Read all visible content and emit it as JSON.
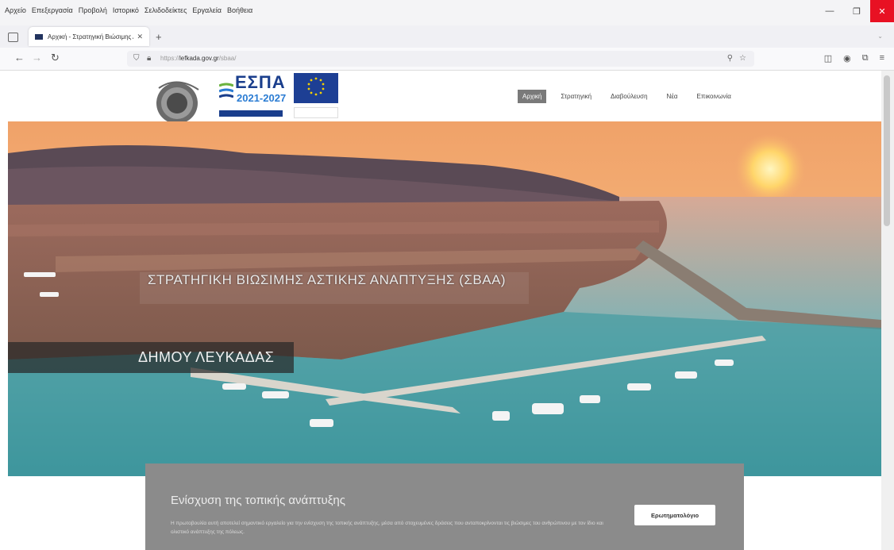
{
  "browser": {
    "menu": [
      "Αρχείο",
      "Επεξεργασία",
      "Προβολή",
      "Ιστορικό",
      "Σελιδοδείκτες",
      "Εργαλεία",
      "Βοήθεια"
    ],
    "tab_title": "Αρχική - Στρατηγική Βιώσιμης Α",
    "url_prefix": "https://",
    "url_domain": "lefkada.gov.gr",
    "url_path": "/sbaa/"
  },
  "site": {
    "logo_espa": "ΕΣΠΑ",
    "logo_espa_years": "2021-2027",
    "nav": [
      {
        "label": "Αρχική",
        "active": true
      },
      {
        "label": "Στρατηγική",
        "active": false
      },
      {
        "label": "Διαβούλευση",
        "active": false
      },
      {
        "label": "Νέα",
        "active": false
      },
      {
        "label": "Επικοινωνία",
        "active": false
      }
    ]
  },
  "hero": {
    "title": "ΣΤΡΑΤΗΓΙΚΗ ΒΙΩΣΙΜΗΣ ΑΣΤΙΚΗΣ ΑΝΑΠΤΥΞΗΣ (ΣΒΑΑ)",
    "subtitle": "ΔΗΜΟΥ ΛΕΥΚΑΔΑΣ"
  },
  "cta": {
    "title": "Ενίσχυση της τοπικής ανάπτυξης",
    "text": "Η πρωτοβουλία αυτή αποτελεί σημαντικό εργαλείο για την ενίσχυση της τοπικής ανάπτυξης, μέσα από στοχευμένες δράσεις που ανταποκρίνονται τις βιώσιμες του ανθρώπινου με τον ίδιο και ολιστικό ανάπτυξης της πόλεως.",
    "button": "Ερωτηματολόγιο"
  },
  "colors": {
    "nav_active_bg": "#7a7a7a",
    "cta_bg": "#8b8b8b",
    "close_button": "#e81123",
    "espa_blue": "#1a3e8c"
  }
}
